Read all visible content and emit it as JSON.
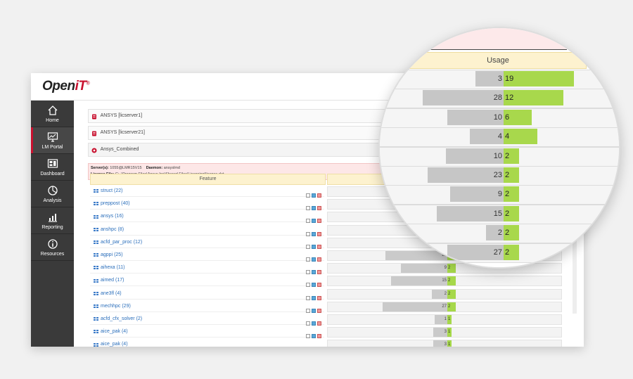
{
  "app": {
    "logo_main": "Open",
    "logo_accent": "iT",
    "logo_mark": "®"
  },
  "sidebar": {
    "items": [
      {
        "label": "Home",
        "icon": "home-icon"
      },
      {
        "label": "LM Portal",
        "icon": "monitor-chart-icon",
        "active": true
      },
      {
        "label": "Dashboard",
        "icon": "dashboard-icon"
      },
      {
        "label": "Analysis",
        "icon": "analysis-icon"
      },
      {
        "label": "Reporting",
        "icon": "reporting-icon"
      },
      {
        "label": "Resources",
        "icon": "info-icon"
      }
    ]
  },
  "panels": [
    {
      "label": "ANSYS [licserver1]"
    },
    {
      "label": "ANSYS [licserver21]"
    },
    {
      "label": "Ansys_Combined"
    }
  ],
  "server_info": {
    "servers_label": "Server(s):",
    "servers_value": "1055@LMR15V15",
    "daemon_label": "Daemon:",
    "daemon_value": "ansyslmd",
    "license_label": "License File:",
    "license_value": "C:_\\Program Files\\Ansys Inc\\Shared Files\\Licensing\\license.dat"
  },
  "table": {
    "feature_header": "Feature",
    "usage_header": "Usage",
    "rows": [
      {
        "name": "struct (22)",
        "gray": "",
        "green": ""
      },
      {
        "name": "preppost (40)",
        "gray": "",
        "green": ""
      },
      {
        "name": "ansys (16)",
        "gray": "",
        "green": ""
      },
      {
        "name": "anshpc (8)",
        "gray": "",
        "green": ""
      },
      {
        "name": "acfd_par_proc (12)",
        "gray": "",
        "green": ""
      },
      {
        "name": "agppi (25)",
        "gray": "23",
        "green": "2"
      },
      {
        "name": "aihexa (11)",
        "gray": "9",
        "green": "2"
      },
      {
        "name": "aimed (17)",
        "gray": "15",
        "green": "2"
      },
      {
        "name": "ane3fl (4)",
        "gray": "2",
        "green": "2"
      },
      {
        "name": "mechhpc (29)",
        "gray": "27",
        "green": "2"
      },
      {
        "name": "acfd_cfx_solver (2)",
        "gray": "1",
        "green": "1"
      },
      {
        "name": "aice_pak (4)",
        "gray": "3",
        "green": "1"
      },
      {
        "name": "aice_pak (4)",
        "gray": "3",
        "green": "1"
      }
    ]
  },
  "magnifier": {
    "rows": [
      {
        "gray": "3",
        "green": "19"
      },
      {
        "gray": "28",
        "green": "12"
      },
      {
        "gray": "10",
        "green": "6"
      },
      {
        "gray": "4",
        "green": "4"
      },
      {
        "gray": "10",
        "green": "2"
      },
      {
        "gray": "23",
        "green": "2"
      },
      {
        "gray": "9",
        "green": "2"
      },
      {
        "gray": "15",
        "green": "2"
      },
      {
        "gray": "2",
        "green": "2"
      },
      {
        "gray": "27",
        "green": "2"
      }
    ]
  },
  "colors": {
    "brand": "#c8102e",
    "sidebar": "#3a3a3a",
    "used": "#a6d84a",
    "available": "#cacaca",
    "header": "#fdf2cf"
  }
}
